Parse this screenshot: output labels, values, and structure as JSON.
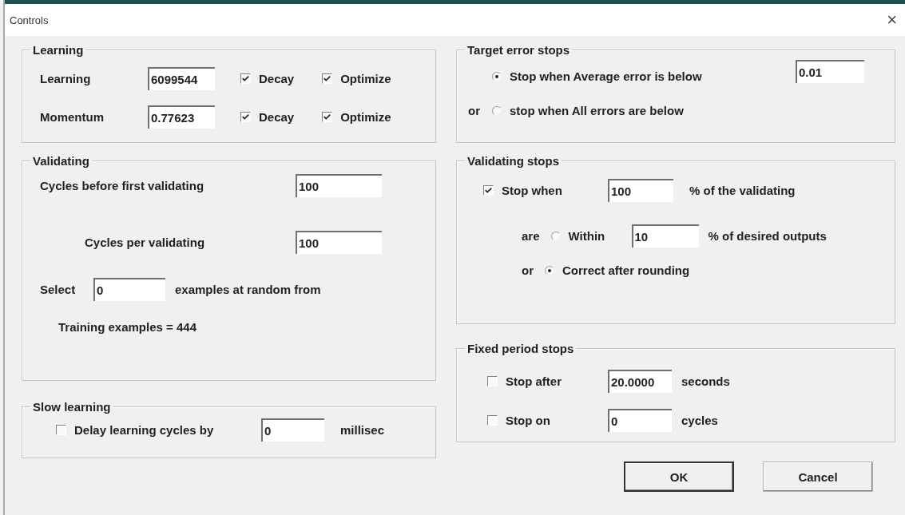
{
  "window": {
    "title": "Controls",
    "close": "×"
  },
  "learning": {
    "title": "Learning",
    "rows": [
      {
        "label": "Learning",
        "value": "6099544",
        "decay": {
          "label": "Decay",
          "checked": true
        },
        "optimize": {
          "label": "Optimize",
          "checked": true
        }
      },
      {
        "label": "Momentum",
        "value": "0.77623",
        "decay": {
          "label": "Decay",
          "checked": true
        },
        "optimize": {
          "label": "Optimize",
          "checked": true
        }
      }
    ]
  },
  "validating": {
    "title": "Validating",
    "first": {
      "label": "Cycles before first validating",
      "value": "100"
    },
    "per": {
      "label": "Cycles per validating",
      "value": "100"
    },
    "select": {
      "label": "Select",
      "value": "0",
      "suffix": "examples at random from"
    },
    "training": "Training examples = 444"
  },
  "slow_learning": {
    "title": "Slow learning",
    "delay": {
      "label": "Delay learning cycles by",
      "checked": false,
      "value": "0",
      "unit": "millisec"
    }
  },
  "target_error": {
    "title": "Target error stops",
    "value": "0.01",
    "options": [
      {
        "label": "Stop when Average error is below",
        "selected": true
      },
      {
        "prefix": "or",
        "label": "stop when All errors are below",
        "selected": false
      }
    ]
  },
  "validating_stops": {
    "title": "Validating stops",
    "stop_when": {
      "label": "Stop when",
      "checked": true,
      "value": "100",
      "suffix": "% of the validating"
    },
    "modes": [
      {
        "prefix": "are",
        "label": "Within",
        "selected": false,
        "value": "10",
        "suffix": "% of desired outputs"
      },
      {
        "prefix": "or",
        "label": "Correct after rounding",
        "selected": true
      }
    ]
  },
  "fixed_period": {
    "title": "Fixed period stops",
    "rows": [
      {
        "label": "Stop after",
        "checked": false,
        "value": "20.0000",
        "unit": "seconds"
      },
      {
        "label": "Stop on",
        "checked": false,
        "value": "0",
        "unit": "cycles"
      }
    ]
  },
  "buttons": [
    {
      "label": "OK",
      "default": true
    },
    {
      "label": "Cancel",
      "default": false
    }
  ]
}
